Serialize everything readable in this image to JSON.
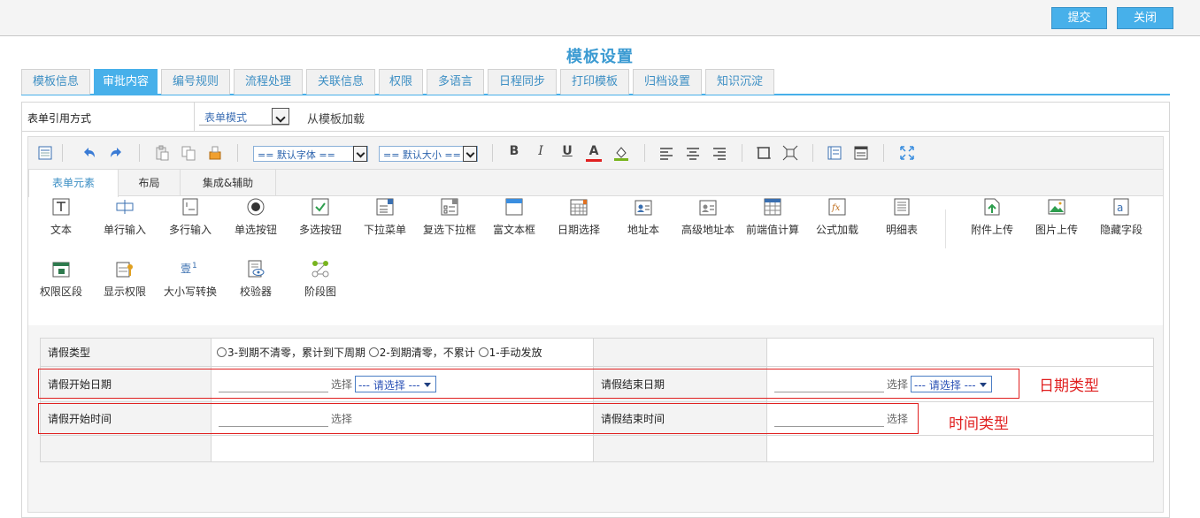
{
  "topbar": {
    "submit_label": "提交",
    "close_label": "关闭"
  },
  "page_title": "模板设置",
  "tabs": [
    {
      "label": "模板信息",
      "active": false
    },
    {
      "label": "审批内容",
      "active": true
    },
    {
      "label": "编号规则",
      "active": false
    },
    {
      "label": "流程处理",
      "active": false
    },
    {
      "label": "关联信息",
      "active": false
    },
    {
      "label": "权限",
      "active": false
    },
    {
      "label": "多语言",
      "active": false
    },
    {
      "label": "日程同步",
      "active": false
    },
    {
      "label": "打印模板",
      "active": false
    },
    {
      "label": "归档设置",
      "active": false
    },
    {
      "label": "知识沉淀",
      "active": false
    }
  ],
  "form_ref": {
    "label": "表单引用方式",
    "mode_value": "表单模式",
    "load_text": "从模板加载"
  },
  "toolbar": {
    "font_select": "== 默认字体 ==",
    "size_select": "== 默认大小 ==",
    "bold": "B",
    "italic": "I",
    "underline": "U",
    "font_color": "A",
    "icons": [
      "source-icon",
      "undo-icon",
      "redo-icon",
      "paste-icon",
      "copy-icon",
      "format-painter-icon",
      "align-left-icon",
      "align-center-icon",
      "align-right-icon",
      "select-all-icon",
      "fit-icon",
      "insert-row-icon",
      "table-icon",
      "fullscreen-icon"
    ],
    "colors": {
      "font_color_bar": "#e02020",
      "fill_color_bar": "#78b41e",
      "accent": "#3a8ee0"
    }
  },
  "subtabs": [
    {
      "label": "表单元素",
      "active": true
    },
    {
      "label": "布局",
      "active": false
    },
    {
      "label": "集成&辅助",
      "active": false
    }
  ],
  "widgets": [
    {
      "label": "文本",
      "icon": "text-icon"
    },
    {
      "label": "单行输入",
      "icon": "single-line-input-icon"
    },
    {
      "label": "多行输入",
      "icon": "multi-line-input-icon"
    },
    {
      "label": "单选按钮",
      "icon": "radio-button-icon"
    },
    {
      "label": "多选按钮",
      "icon": "checkbox-icon"
    },
    {
      "label": "下拉菜单",
      "icon": "dropdown-menu-icon"
    },
    {
      "label": "复选下拉框",
      "icon": "multi-select-dropdown-icon"
    },
    {
      "label": "富文本框",
      "icon": "rich-text-icon"
    },
    {
      "label": "日期选择",
      "icon": "date-picker-icon"
    },
    {
      "label": "地址本",
      "icon": "address-book-icon"
    },
    {
      "label": "高级地址本",
      "icon": "advanced-address-book-icon"
    },
    {
      "label": "前端值计算",
      "icon": "calculator-icon"
    },
    {
      "label": "公式加载",
      "icon": "formula-icon"
    },
    {
      "label": "明细表",
      "icon": "detail-table-icon"
    },
    {
      "label": "附件上传",
      "icon": "attachment-upload-icon"
    },
    {
      "label": "图片上传",
      "icon": "image-upload-icon"
    },
    {
      "label": "隐藏字段",
      "icon": "hidden-field-icon"
    },
    {
      "label": "权限区段",
      "icon": "permission-section-icon"
    },
    {
      "label": "显示权限",
      "icon": "display-permission-icon"
    },
    {
      "label": "大小写转换",
      "icon": "case-convert-icon"
    },
    {
      "label": "校验器",
      "icon": "validator-icon"
    },
    {
      "label": "阶段图",
      "icon": "stage-diagram-icon"
    }
  ],
  "form": {
    "leave_type_label": "请假类型",
    "leave_options": [
      "3-到期不清零，累计到下周期",
      "2-到期清零，不累计",
      "1-手动发放"
    ],
    "start_date_label": "请假开始日期",
    "end_date_label": "请假结束日期",
    "start_time_label": "请假开始时间",
    "end_time_label": "请假结束时间",
    "choose_text": "选择",
    "dropdown_placeholder": "--- 请选择 ---"
  },
  "annotations": {
    "date_type": "日期类型",
    "time_type": "时间类型",
    "color": "#e02020"
  }
}
